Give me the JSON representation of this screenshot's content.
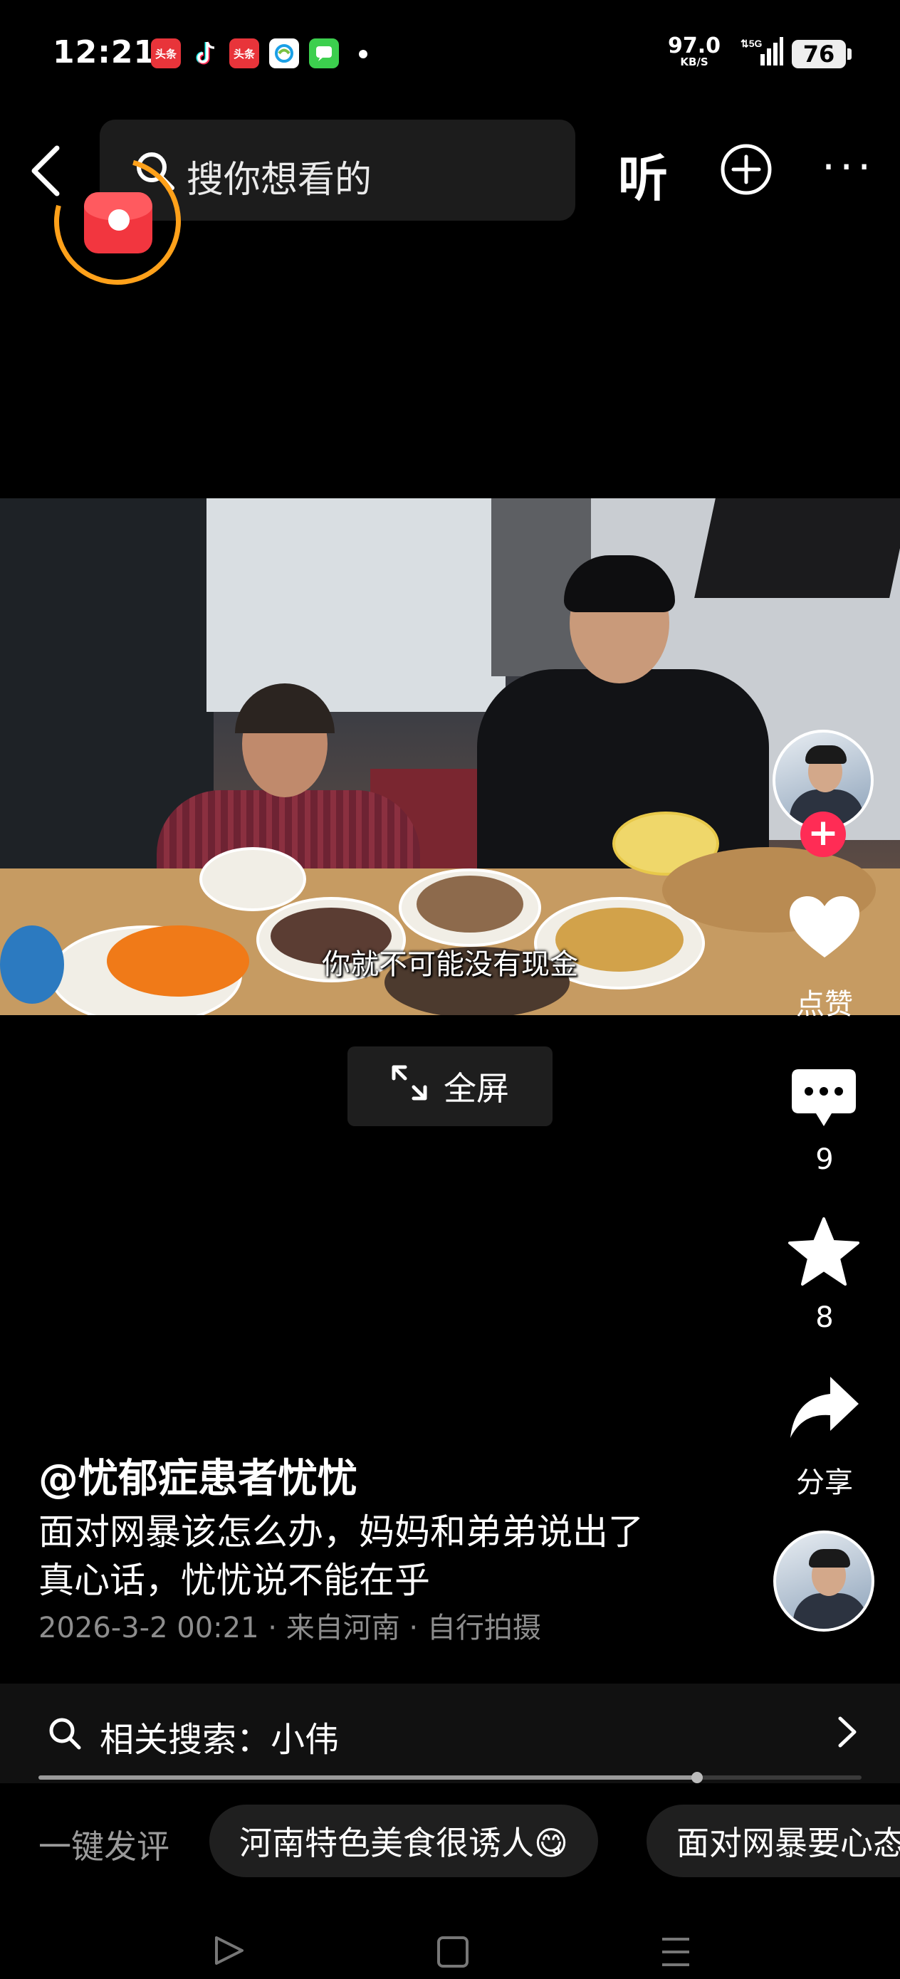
{
  "status_bar": {
    "time": "12:21",
    "notif_icons": [
      {
        "icon": "toutiao-icon",
        "label": "头条",
        "color": "#e8343a"
      },
      {
        "icon": "tiktok-icon",
        "label": "",
        "color": "#000000"
      },
      {
        "icon": "toutiao-icon",
        "label": "头条",
        "color": "#e8343a"
      },
      {
        "icon": "china-mobile-icon",
        "label": "",
        "color": "#ffffff"
      },
      {
        "icon": "messages-icon",
        "label": "",
        "color": "#3ccf4e"
      }
    ],
    "net_speed": "97.0",
    "net_unit": "KB/S",
    "network": "5G",
    "battery": "76"
  },
  "top_bar": {
    "search_placeholder": "搜你想看的",
    "listen_label": "听"
  },
  "video": {
    "subtitle": "你就不可能没有现金",
    "fullscreen_label": "全屏"
  },
  "actions": {
    "like_label": "点赞",
    "comments": "9",
    "favorites": "8",
    "share_label": "分享"
  },
  "post": {
    "author": "@忧郁症患者忧忧",
    "desc_line1": "面对网暴该怎么办，妈妈和弟弟说出了",
    "desc_line2": "真心话，忧忧说不能在乎",
    "meta": "2026-3-2 00:21 · 来自河南 · 自行拍摄"
  },
  "related": {
    "label": "相关搜索：小伟",
    "progress": 0.8
  },
  "quick_comments": {
    "label": "一键发评",
    "chips": [
      "河南特色美食很诱人😋",
      "面对网暴要心态"
    ]
  },
  "colors": {
    "accent_red": "#ff2c55",
    "redpack_ring": "#ffa11a"
  }
}
